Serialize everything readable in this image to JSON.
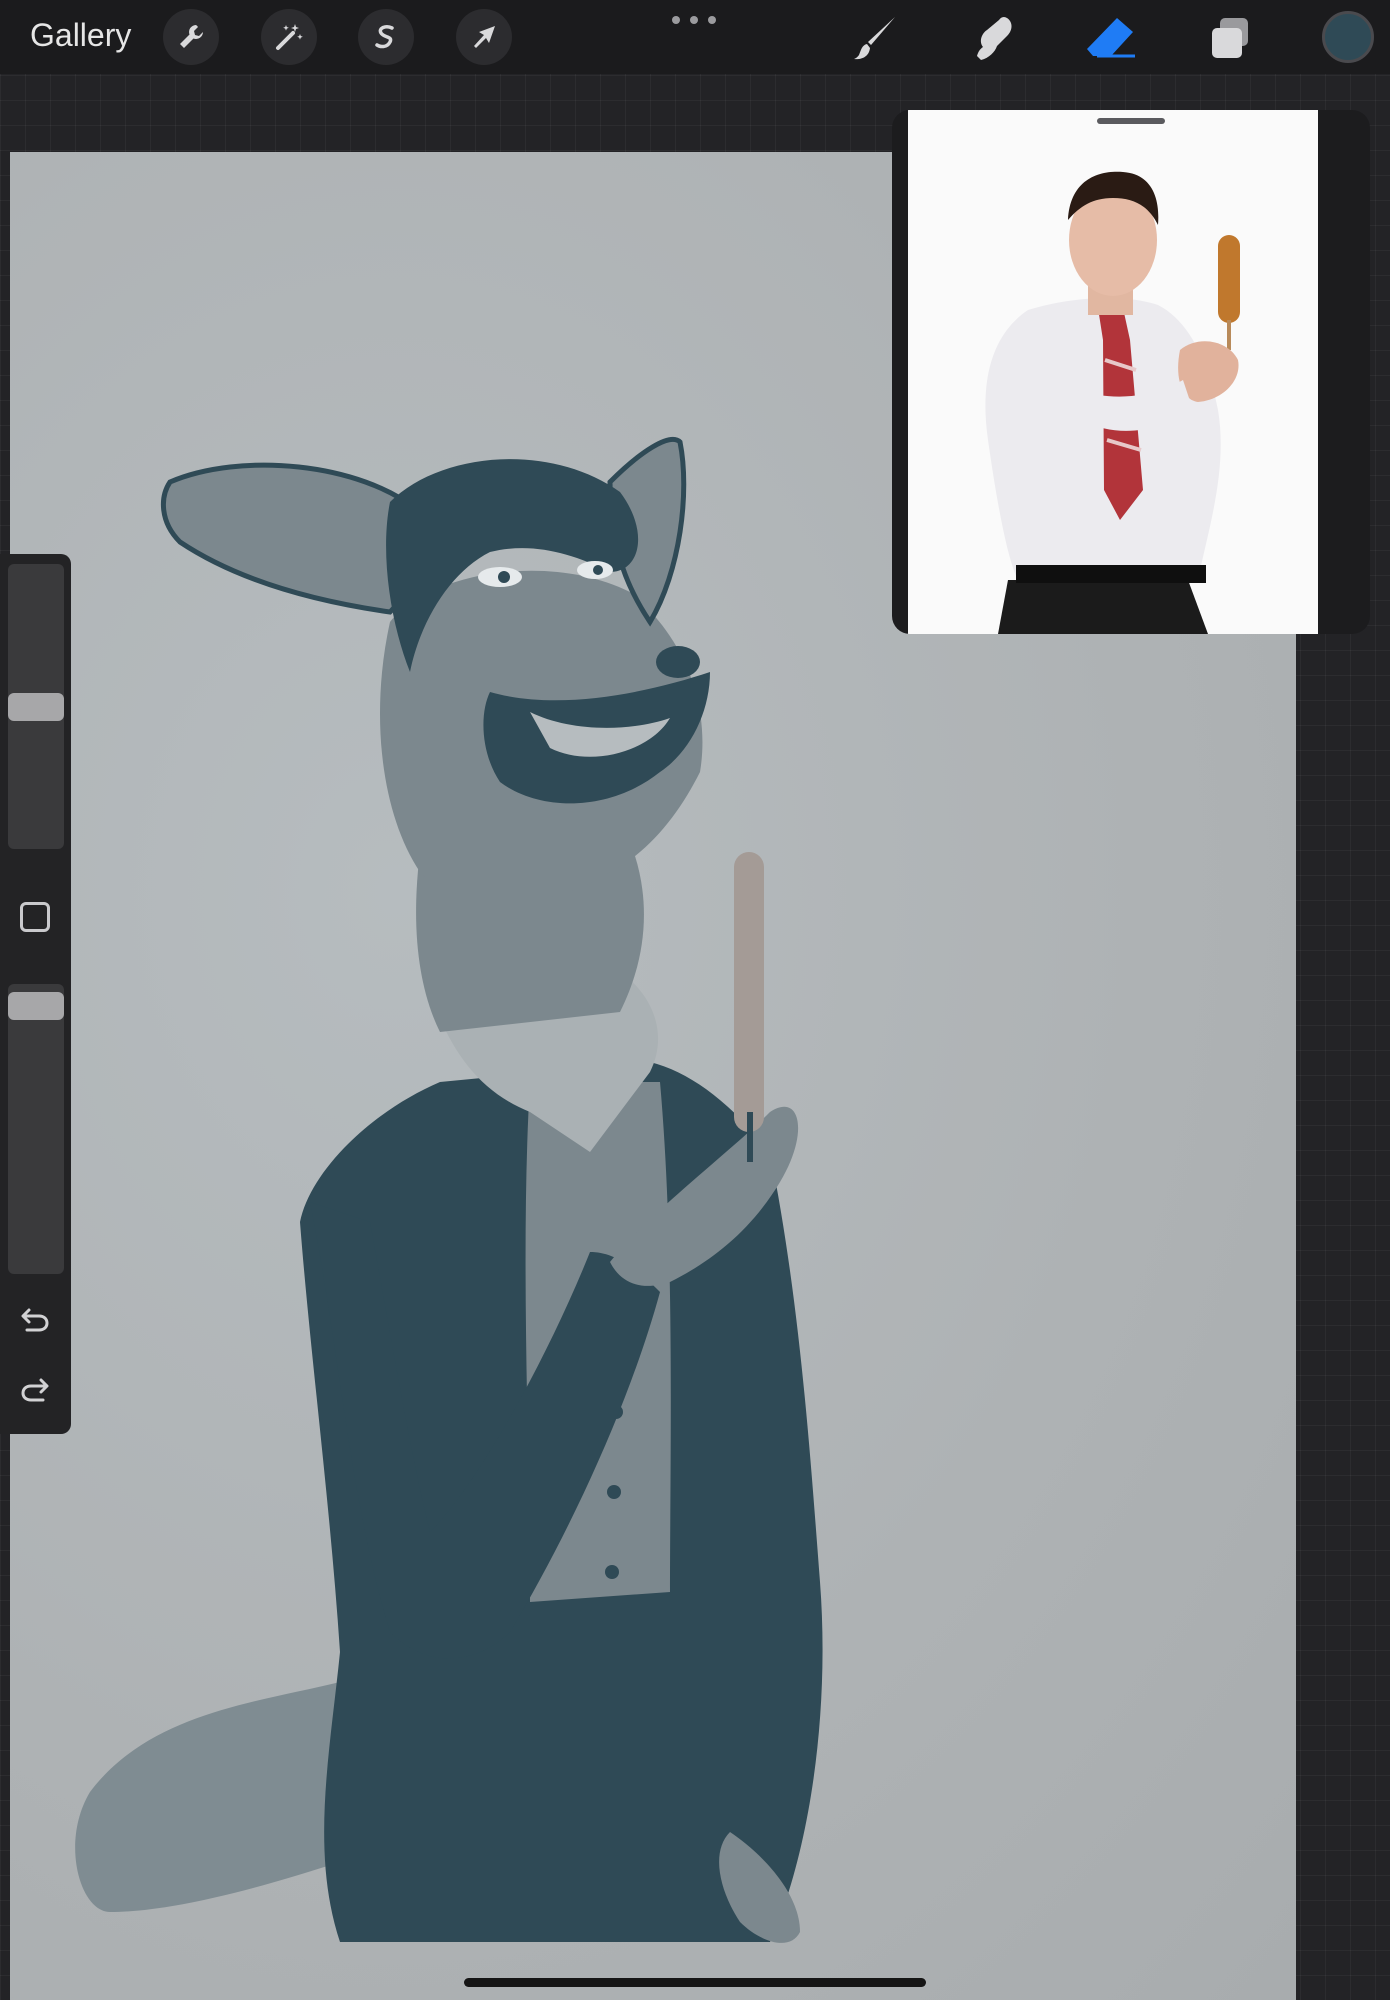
{
  "topbar": {
    "gallery_label": "Gallery",
    "left_tools": [
      {
        "icon": "wrench-icon"
      },
      {
        "icon": "magic-wand-icon"
      },
      {
        "icon": "selection-s-icon"
      },
      {
        "icon": "arrow-cursor-icon"
      }
    ],
    "more_icon": "ellipsis-icon",
    "right_tools": [
      {
        "icon": "brush-icon"
      },
      {
        "icon": "smudge-icon"
      },
      {
        "icon": "eraser-icon",
        "active": true
      },
      {
        "icon": "layers-icon"
      }
    ],
    "current_color": "#2f4a56",
    "active_accent": "#1f7cf5"
  },
  "canvas": {
    "background_color": "#aeb2b4",
    "ink_color": "#2f4a56"
  },
  "reference_window": {
    "handle_icon": "drag-handle-icon"
  },
  "sidebar": {
    "size_slider_level": 0.5,
    "opacity_slider_level": 0.03,
    "modifier_icon": "modifier-square-icon",
    "undo_icon": "undo-icon",
    "redo_icon": "redo-icon"
  }
}
